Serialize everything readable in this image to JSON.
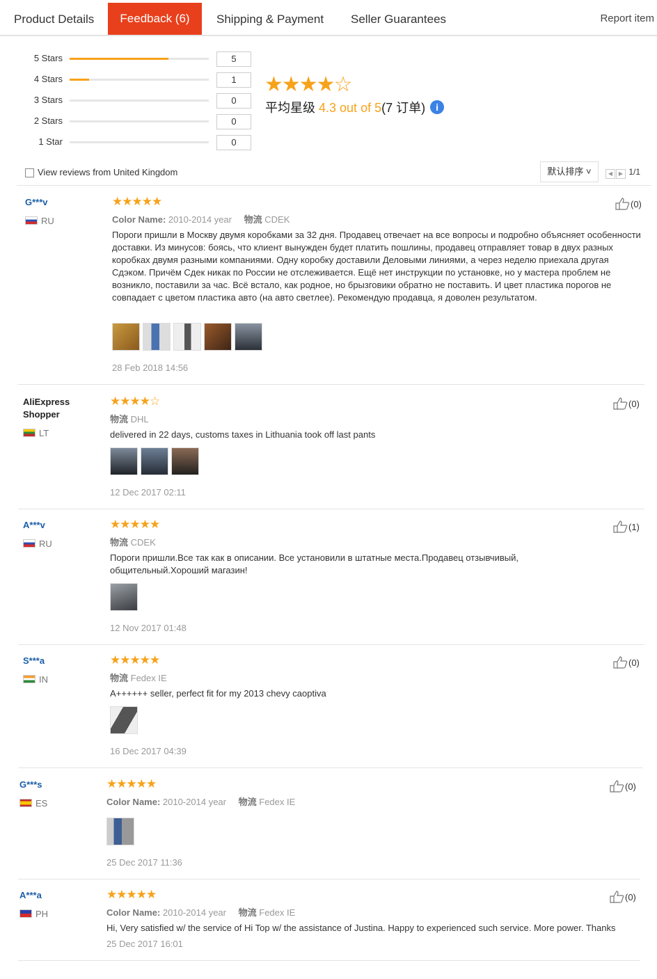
{
  "tabs": [
    {
      "label": "Product Details"
    },
    {
      "label": "Feedback (6)",
      "active": true
    },
    {
      "label": "Shipping & Payment"
    },
    {
      "label": "Seller Guarantees"
    }
  ],
  "report_label": "Report item",
  "histogram": [
    {
      "label": "5 Stars",
      "count": "5",
      "fraction": 0.71
    },
    {
      "label": "4 Stars",
      "count": "1",
      "fraction": 0.14
    },
    {
      "label": "3 Stars",
      "count": "0",
      "fraction": 0
    },
    {
      "label": "2 Stars",
      "count": "0",
      "fraction": 0
    },
    {
      "label": "1 Star",
      "count": "0",
      "fraction": 0
    }
  ],
  "average": {
    "stars": "★★★★☆",
    "label": "平均星级",
    "score": "4.3 out of 5",
    "orders": "(7 订单)",
    "info_glyph": "i"
  },
  "filter": {
    "label": "View reviews from United Kingdom",
    "sort_label": "默认排序 ˅",
    "page": "1/1",
    "prev_glyph": "◀",
    "next_glyph": "▶"
  },
  "reviews": [
    {
      "name": "G***v",
      "country": "RU",
      "flag": "flag-ru",
      "stars": "★★★★★",
      "color_label": "Color Name:",
      "color_value": "2010-2014 year",
      "shipping_label": "物流",
      "shipping_value": "CDEK",
      "text": "Пороги пришли в Москву двумя коробками за 32 дня. Продавец отвечает на все вопросы и подробно объясняет особенности доставки. Из минусов: боясь, что клиент вынужден будет платить пошлины, продавец отправляет товар в двух разных коробках двумя разными компаниями. Одну коробку доставили Деловыми линиями, а через неделю приехала другая Сдэком. Причём Сдек никак по России не отслеживается. Ещё нет инструкции по установке, но у мастера проблем не возникло, поставили за час. Всё встало, как родное, но брызговики обратно не поставить. И цвет пластика порогов не совпадает с цветом пластика авто (на авто светлее). Рекомендую продавца, я доволен результатом.",
      "date": "28 Feb 2018 14:56",
      "likes": "(0)",
      "photos": [
        {
          "name": "photo-sill-box",
          "color": "#b8862e"
        },
        {
          "name": "photo-sill-blue",
          "color": "#4a73b0"
        },
        {
          "name": "photo-sill-plastic",
          "color": "#555555"
        },
        {
          "name": "photo-car-interior",
          "color": "#7a4a24"
        },
        {
          "name": "photo-car-exterior",
          "color": "#3a3f46"
        }
      ]
    },
    {
      "name": "AliExpress Shopper",
      "country": "LT",
      "flag": "flag-lt",
      "stars": "★★★★☆",
      "shipping_label": "物流",
      "shipping_value": "DHL",
      "text": "delivered in 22 days, customs taxes in Lithuania took off last pants",
      "date": "12 Dec 2017 02:11",
      "likes": "(0)",
      "photos": [
        {
          "name": "photo-suv-front",
          "color": "#2c3138"
        },
        {
          "name": "photo-suv-side",
          "color": "#394250"
        },
        {
          "name": "photo-suv-rear",
          "color": "#4a3b34"
        }
      ]
    },
    {
      "name": "A***v",
      "country": "RU",
      "flag": "flag-ru",
      "stars": "★★★★★",
      "shipping_label": "物流",
      "shipping_value": "CDEK",
      "text": "Пороги пришли.Все так как в описании. Все установили в штатные места.Продавец отзывчивый, общительный.Хороший магазин!",
      "date": "12 Nov 2017 01:48",
      "likes": "(1)",
      "photos": [
        {
          "name": "photo-installed-sill",
          "color": "#5a5e63"
        }
      ]
    },
    {
      "name": "S***a",
      "country": "IN",
      "flag": "flag-in",
      "stars": "★★★★★",
      "shipping_label": "物流",
      "shipping_value": "Fedex IE",
      "text": "A++++++ seller, perfect fit for my 2013 chevy caoptiva",
      "date": "16 Dec 2017 04:39",
      "likes": "(0)",
      "photos": [
        {
          "name": "photo-side-step",
          "color": "#6b6b6b"
        }
      ]
    },
    {
      "name": "G***s",
      "country": "ES",
      "flag": "flag-es",
      "stars": "★★★★★",
      "color_label": "Color Name:",
      "color_value": "2010-2014 year",
      "shipping_label": "物流",
      "shipping_value": "Fedex IE",
      "date": "25 Dec 2017 11:36",
      "likes": "(0)",
      "photos": [
        {
          "name": "photo-package",
          "color": "#3d5f94"
        }
      ]
    },
    {
      "name": "A***a",
      "country": "PH",
      "flag": "flag-ph",
      "stars": "★★★★★",
      "color_label": "Color Name:",
      "color_value": "2010-2014 year",
      "shipping_label": "物流",
      "shipping_value": "Fedex IE",
      "text": "Hi, Very satisfied w/ the service of Hi Top w/ the assistance of Justina. Happy to experienced such service. More power. Thanks",
      "date": "25 Dec 2017 16:01",
      "likes": "(0)",
      "photos": []
    }
  ],
  "colors": {
    "accent": "#e8401c",
    "star": "#f7a21a",
    "link": "#1a5ea8",
    "info": "#3b82e5"
  }
}
